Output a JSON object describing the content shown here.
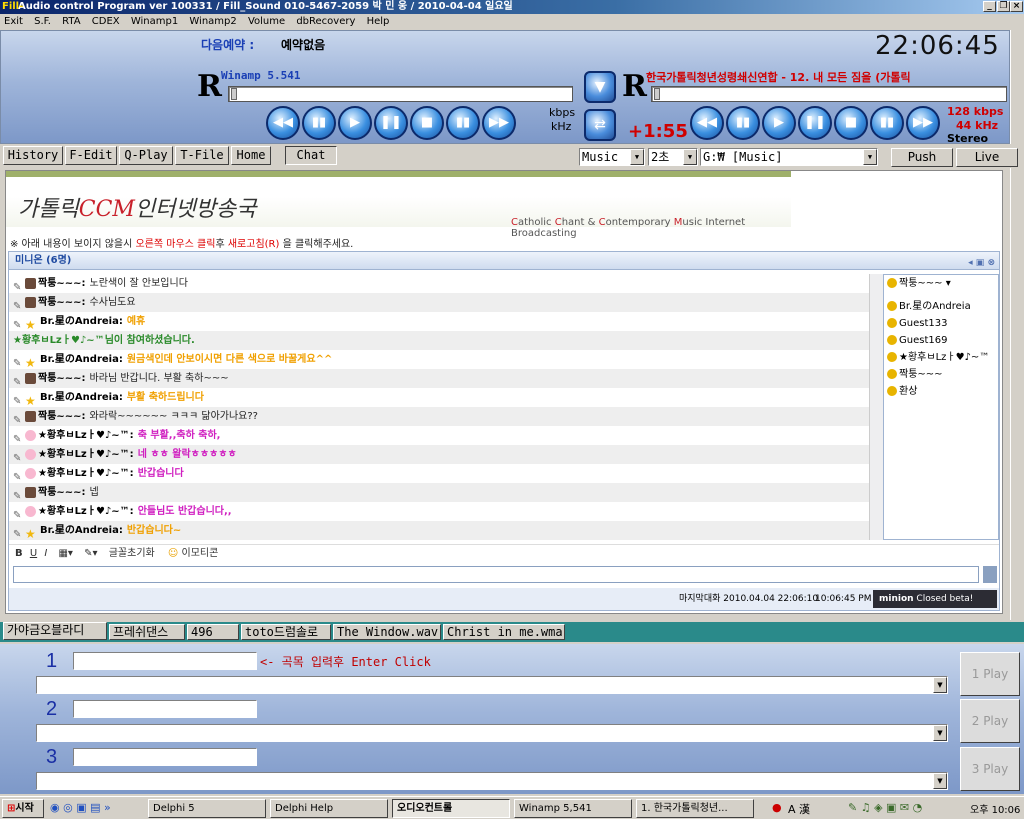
{
  "window": {
    "logo": "Fill-",
    "title": "Audio control Program   ver 100331   /   Fill_Sound     010-5467-2059   박 민 웅   /   2010-04-04 일요일"
  },
  "menu": [
    "Exit",
    "S.F.",
    "RTA",
    "CDEX",
    "Winamp1",
    "Winamp2",
    "Volume",
    "dbRecovery",
    "Help"
  ],
  "header": {
    "next_label": "다음예약 :",
    "next_value": "예약없음",
    "clock": "22:06:45"
  },
  "player1": {
    "name": "Winamp 5.541",
    "kbps_label": "kbps",
    "khz_label": "kHz"
  },
  "player2": {
    "track": "한국가톨릭청년성령쇄신연합 - 12. 내 모든 짐을 (가톨릭",
    "time": "+1:55",
    "kbps": "128 kbps",
    "khz": "44 kHz",
    "mode": "Stereo"
  },
  "tabs": [
    "History",
    "F-Edit",
    "Q-Play",
    "T-File",
    "Home",
    "Chat"
  ],
  "controls": {
    "category": "Music",
    "interval": "2초",
    "folder": "G:₩ [Music]",
    "push": "Push",
    "live": "Live"
  },
  "web": {
    "brand_prefix": "가톨릭",
    "brand_ccm": "CCM",
    "brand_suffix": "인터넷방송국",
    "sub_c1": "C",
    "sub_t1": "atholic ",
    "sub_c2": "C",
    "sub_t2": "hant & ",
    "sub_c3": "C",
    "sub_t3": "ontemporary ",
    "sub_c4": "M",
    "sub_t4": "usic Internet Broadcasting",
    "notice_a": "※ 아래 내용이 보이지 않을시 ",
    "notice_b": "오른쪽 마우스 클릭",
    "notice_c": "후 ",
    "notice_d": "새로고침(R)",
    "notice_e": " 을 클릭해주세요."
  },
  "chat": {
    "header": "미니온 (6명)",
    "messages": [
      {
        "nick": "짝퉁~~~:",
        "text": "노란색이 잘 안보입니다",
        "color": "#222222",
        "icon": "av"
      },
      {
        "nick": "짝퉁~~~:",
        "text": "수사님도요",
        "color": "#222222",
        "icon": "av"
      },
      {
        "nick": "Br.星のAndreia:",
        "text": "예휴",
        "color": "#f0a000",
        "icon": "star"
      },
      {
        "nick": "★황후ㅂLzㅏ♥♪~™",
        "text": "님이 참여하셨습니다.",
        "color": "#2a8a2a",
        "icon": "none"
      },
      {
        "nick": "Br.星のAndreia:",
        "text": "원금색인데 안보이시면 다른 색으로 바꿀게요^^",
        "color": "#f0a000",
        "icon": "star"
      },
      {
        "nick": "짝퉁~~~:",
        "text": "바라님 반갑니다. 부활 축하~~~",
        "color": "#222222",
        "icon": "av"
      },
      {
        "nick": "Br.星のAndreia:",
        "text": "부활 축하드립니다",
        "color": "#f0a000",
        "icon": "star"
      },
      {
        "nick": "짝퉁~~~:",
        "text": "와라락~~~~~~ ㅋㅋㅋ 닮아가나요??",
        "color": "#222222",
        "icon": "av"
      },
      {
        "nick": "★황후ㅂLzㅏ♥♪~™:",
        "text": "축 부활,,축하 축하,",
        "color": "#d020c0",
        "icon": "pig"
      },
      {
        "nick": "★황후ㅂLzㅏ♥♪~™:",
        "text": "네 ㅎㅎ 왈락ㅎㅎㅎㅎㅎ",
        "color": "#d020c0",
        "icon": "pig"
      },
      {
        "nick": "★황후ㅂLzㅏ♥♪~™:",
        "text": "반갑습니다",
        "color": "#d020c0",
        "icon": "pig"
      },
      {
        "nick": "짝퉁~~~:",
        "text": "넵",
        "color": "#222222",
        "icon": "av"
      },
      {
        "nick": "★황후ㅂLzㅏ♥♪~™:",
        "text": "안들님도 반갑습니다,,",
        "color": "#d020c0",
        "icon": "pig"
      },
      {
        "nick": "Br.星のAndreia:",
        "text": "반갑습니다~",
        "color": "#f0a000",
        "icon": "star"
      }
    ],
    "users_header": "짝퉁~~~ ▾",
    "users": [
      "Br.星のAndreia",
      "Guest133",
      "Guest169",
      "★황후ㅂLzㅏ♥♪~™",
      "짝퉁~~~",
      "환상"
    ],
    "tool_font": "글꼴초기화",
    "tool_emoticon": "이모티콘",
    "last_chat_label": "마지막대화 2010.04.04 22:06:10",
    "time": "10:06:45 PM",
    "brand": "minion",
    "status": "Closed beta!"
  },
  "bottom_tabs": [
    "가야금오블라디",
    "프레쉬댄스",
    "496",
    "toto드럼솔로",
    "The Window.wav",
    "Christ in me.wma"
  ],
  "queue": {
    "hint": "<- 곡목 입력후 Enter Click",
    "rows": [
      {
        "num": "1",
        "play": "1 Play"
      },
      {
        "num": "2",
        "play": "2 Play"
      },
      {
        "num": "3",
        "play": "3 Play"
      }
    ]
  },
  "taskbar": {
    "start": "시작",
    "items": [
      "Delphi 5",
      "Delphi Help",
      "오디오컨트롤",
      "Winamp 5,541",
      "1. 한국가톨릭청년..."
    ],
    "clock": "오후 10:06",
    "lang": "A 漢"
  }
}
